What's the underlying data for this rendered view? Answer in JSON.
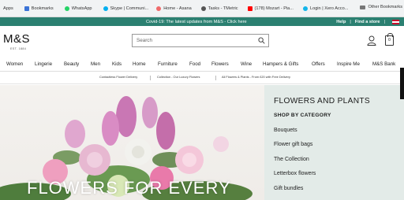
{
  "bookmarks_bar": {
    "apps": "Apps",
    "items": [
      {
        "label": "Bookmarks",
        "color": "#3b73d6"
      },
      {
        "label": "WhatsApp",
        "color": "#25d366"
      },
      {
        "label": "Skype | Communi...",
        "color": "#00aff0"
      },
      {
        "label": "Home - Asana",
        "color": "#f06a6a"
      },
      {
        "label": "Tasks - TMetric",
        "color": "#555555"
      },
      {
        "label": "(178) Mozart - Pia...",
        "color": "#ff0000"
      },
      {
        "label": "Login | Xero Acco...",
        "color": "#13b5ea"
      }
    ],
    "other": "Other Bookmarks"
  },
  "covid_banner": {
    "text": "Covid-19: The latest updates from M&S - Click here",
    "help": "Help",
    "find_store": "Find a store",
    "bg_color": "#2b8071"
  },
  "header": {
    "logo": "M&S",
    "logo_est": "EST. 1884",
    "search_placeholder": "Search",
    "bag_count": "0"
  },
  "nav": {
    "items": [
      "Women",
      "Lingerie",
      "Beauty",
      "Men",
      "Kids",
      "Home",
      "Furniture",
      "Food",
      "Flowers",
      "Wine",
      "Hampers & Gifts",
      "Offers",
      "Inspire Me",
      "M&S Bank"
    ]
  },
  "subnav": {
    "items": [
      "Contactless Flower Delivery",
      "Collection - Our Luxury Flowers",
      "All Flowers & Plants - From £20 with Free Delivery"
    ]
  },
  "hero": {
    "headline": "FLOWERS FOR EVERY"
  },
  "panel": {
    "title": "FLOWERS AND PLANTS",
    "subtitle": "SHOP BY CATEGORY",
    "links": [
      "Bouquets",
      "Flower gift bags",
      "The Collection",
      "Letterbox flowers",
      "Gift bundles"
    ],
    "bg_color": "#e3ebe8"
  }
}
